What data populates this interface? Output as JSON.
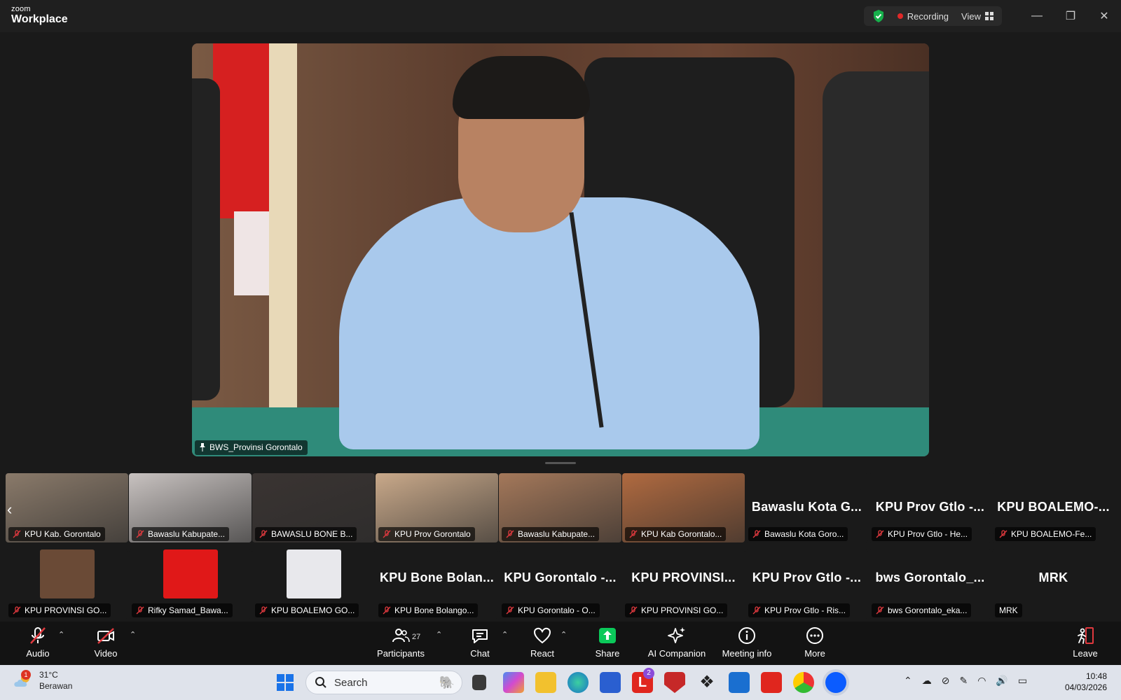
{
  "app": {
    "brand_top": "zoom",
    "brand_bottom": "Workplace"
  },
  "titlebar": {
    "recording_label": "Recording",
    "view_label": "View",
    "minimize": "—",
    "restore": "❐",
    "close": "✕"
  },
  "speaker": {
    "name": "BWS_Provinsi Gorontalo"
  },
  "gallery_row1": [
    {
      "label": "KPU Kab. Gorontalo",
      "video": true,
      "color": "#8a7a6a"
    },
    {
      "label": "Bawaslu Kabupate...",
      "video": true,
      "color": "#c8c2c0"
    },
    {
      "label": "BAWASLU BONE B...",
      "video": true,
      "color": "#3a3432"
    },
    {
      "label": "KPU Prov Gorontalo",
      "video": true,
      "color": "#c9a98a"
    },
    {
      "label": "Bawaslu Kabupate...",
      "video": true,
      "color": "#a4785a"
    },
    {
      "label": "KPU Kab Gorontalo...",
      "video": true,
      "color": "#b06a40"
    },
    {
      "label": "Bawaslu Kota Goro...",
      "name": "Bawaslu Kota G...",
      "video": false
    },
    {
      "label": "KPU Prov Gtlo - He...",
      "name": "KPU Prov Gtlo -...",
      "video": false
    },
    {
      "label": "KPU BOALEMO-Fe...",
      "name": "KPU BOALEMO-...",
      "video": false
    }
  ],
  "gallery_row2": [
    {
      "label": "KPU PROVINSI GO...",
      "thumb": "#6a4a36"
    },
    {
      "label": "Rifky Samad_Bawa...",
      "thumb": "#e01818"
    },
    {
      "label": "KPU BOALEMO GO...",
      "thumb": "#e8e8ec"
    },
    {
      "label": "KPU Bone Bolango...",
      "name": "KPU Bone Bolan..."
    },
    {
      "label": "KPU Gorontalo - O...",
      "name": "KPU Gorontalo -..."
    },
    {
      "label": "KPU PROVINSI GO...",
      "name": "KPU PROVINSI..."
    },
    {
      "label": "KPU Prov Gtlo - Ris...",
      "name": "KPU Prov Gtlo -..."
    },
    {
      "label": "bws Gorontalo_eka...",
      "name": "bws Gorontalo_..."
    },
    {
      "label": "MRK",
      "name": "MRK"
    }
  ],
  "toolbar": {
    "audio": "Audio",
    "video": "Video",
    "participants": "Participants",
    "participants_count": "27",
    "chat": "Chat",
    "react": "React",
    "share": "Share",
    "ai_companion": "AI Companion",
    "meeting_info": "Meeting info",
    "more": "More",
    "leave": "Leave"
  },
  "taskbar": {
    "weather_temp": "31°C",
    "weather_desc": "Berawan",
    "weather_badge": "1",
    "search_placeholder": "Search",
    "time": "10:48",
    "date": "04/03/2026",
    "mail_badge": "2"
  },
  "colors": {
    "share_green": "#0bc95a",
    "mute_red": "#e0393e",
    "zoom_blue": "#0b5cff"
  }
}
